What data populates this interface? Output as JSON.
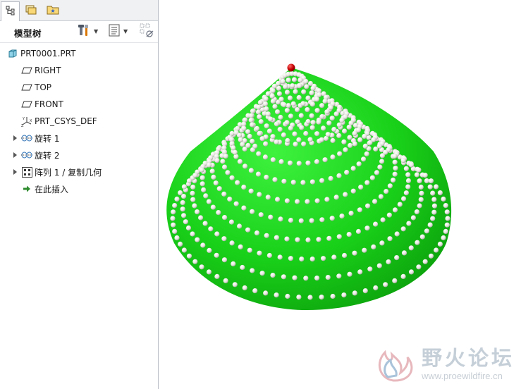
{
  "tabs": [
    {
      "icon": "model-tree-icon",
      "active": true
    },
    {
      "icon": "folder-browser-icon",
      "active": false
    },
    {
      "icon": "favorites-icon",
      "active": false
    }
  ],
  "toolbar": {
    "title": "模型树",
    "settings_icon": "tools-icon",
    "show_icon": "list-display-icon",
    "filter_icon": "tree-filter-icon"
  },
  "tree": {
    "items": [
      {
        "label": "PRT0001.PRT",
        "icon": "part-icon",
        "expandable": false
      },
      {
        "label": "RIGHT",
        "icon": "datum-plane-icon",
        "expandable": false
      },
      {
        "label": "TOP",
        "icon": "datum-plane-icon",
        "expandable": false
      },
      {
        "label": "FRONT",
        "icon": "datum-plane-icon",
        "expandable": false
      },
      {
        "label": "PRT_CSYS_DEF",
        "icon": "csys-icon",
        "expandable": false
      },
      {
        "label": "旋转 1",
        "icon": "revolve-icon",
        "expandable": true
      },
      {
        "label": "旋转 2",
        "icon": "revolve-icon",
        "expandable": true
      },
      {
        "label": "阵列 1 / 复制几何",
        "icon": "pattern-icon",
        "expandable": true
      },
      {
        "label": "在此插入",
        "icon": "insert-here-arrow-icon",
        "expandable": false
      }
    ]
  },
  "model": {
    "body_color": "#19d019",
    "bead_color": "#f2f2ec",
    "tip_color": "#c40000"
  },
  "watermark": {
    "title": "野火论坛",
    "url": "www.proewildfire.cn"
  }
}
